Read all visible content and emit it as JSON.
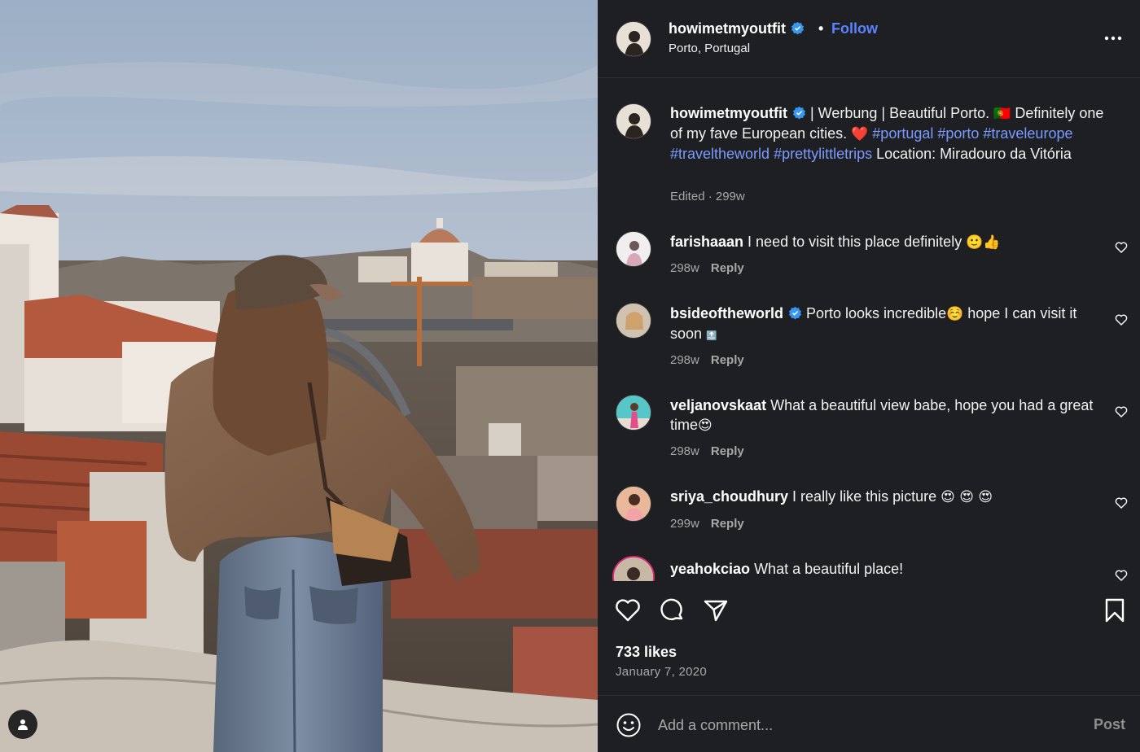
{
  "post": {
    "username": "howimetmyoutfit",
    "follow_label": "Follow",
    "dot": "•",
    "location": "Porto, Portugal",
    "likes": "733 likes",
    "date": "January 7, 2020"
  },
  "caption": {
    "username": "howimetmyoutfit",
    "text_1": " | Werbung | Beautiful Porto. ",
    "flag": "🇵🇹",
    "text_2": " Definitely one of my fave European cities. ",
    "heart": "❤️",
    "tags_1": "#portugal #porto #traveleurope #traveltheworld #prettylittletrips",
    "text_3": " Location: Miradouro da Vitória",
    "meta": "Edited · 299w"
  },
  "comments": [
    {
      "username": "farishaaan",
      "text": " I need to visit this place definitely ",
      "emoji": "🙂👍",
      "age": "298w",
      "reply": "Reply"
    },
    {
      "username": "bsideoftheworld",
      "text": " Porto looks incredible",
      "emoji": "☺️",
      "text_after": " hope I can visit it soon ",
      "emoji_after": "🔝",
      "age": "298w",
      "reply": "Reply"
    },
    {
      "username": "veljanovskaat",
      "text": " What a beautiful view babe, hope you had a great time",
      "emoji": "😍",
      "age": "298w",
      "reply": "Reply"
    },
    {
      "username": "sriya_choudhury",
      "text": " I really like this picture ",
      "emoji": "😍 😍 😍",
      "age": "299w",
      "reply": "Reply"
    },
    {
      "username": "yeahokciao",
      "text": " What a beautiful place!"
    }
  ],
  "compose": {
    "placeholder": "Add a comment...",
    "post_label": "Post"
  },
  "icons": {
    "verified": "verified-badge-icon",
    "more": "more-options-icon",
    "like": "heart-icon",
    "comment": "comment-bubble-icon",
    "share": "paper-plane-icon",
    "save": "bookmark-icon",
    "emoji": "emoji-smiley-icon",
    "user_tag": "user-icon"
  },
  "colors": {
    "panel_bg": "#1e1f22",
    "link_blue": "#5b82ff",
    "hashtag": "#7b9bff",
    "muted": "#a8a8a8"
  }
}
